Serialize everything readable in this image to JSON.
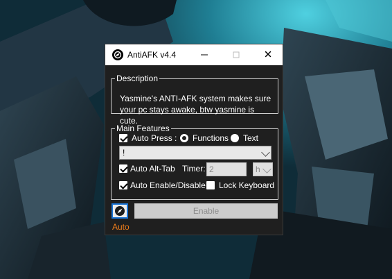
{
  "window": {
    "title": "AntiAFK v4.4",
    "close_glyph": "✕"
  },
  "description": {
    "legend": "Description",
    "text": "Yasmine's ANTI-AFK system makes sure your pc stays awake, btw yasmine is cute."
  },
  "features": {
    "legend": "Main Features",
    "auto_press": {
      "label": "Auto Press :",
      "checked": true
    },
    "mode_functions": {
      "label": "Functions",
      "selected": true
    },
    "mode_text": {
      "label": "Text",
      "selected": false
    },
    "key_select": {
      "value": "!"
    },
    "auto_alt_tab": {
      "label": "Auto Alt-Tab",
      "checked": true
    },
    "timer": {
      "label": "Timer:",
      "value": "2"
    },
    "unit_select": {
      "value": "h"
    },
    "auto_enable": {
      "label": "Auto Enable/Disable",
      "checked": true
    },
    "lock_keyboard": {
      "label": "Lock Keyboard",
      "checked": false
    }
  },
  "footer": {
    "enable_button": "Enable",
    "auto_label": "Auto"
  },
  "colors": {
    "window_bg": "#1f1f1f",
    "accent_orange": "#f07d1a",
    "focus_blue": "#1a74d6",
    "wallpaper": "#1a2630"
  },
  "icons": {
    "app": "antiafk-app-icon",
    "auto": "compass-needle-icon"
  }
}
